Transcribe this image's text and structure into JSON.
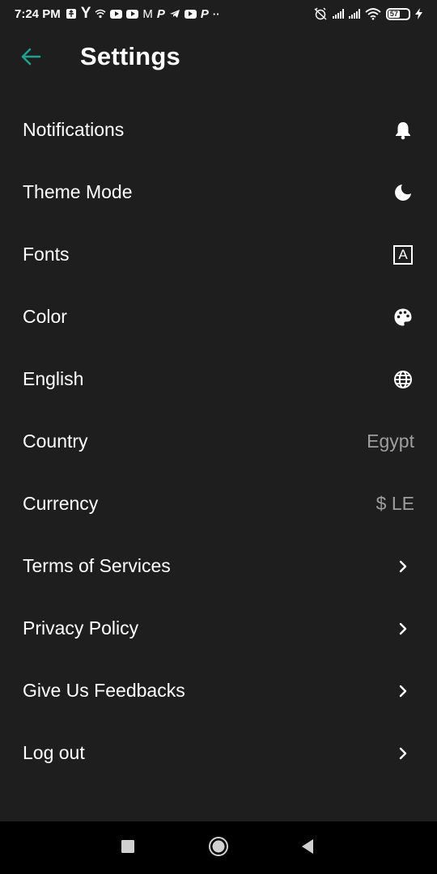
{
  "status_bar": {
    "time": "7:24 PM",
    "letter_y": "Y",
    "letter_m": "M",
    "letter_p": "P",
    "dots": "··",
    "battery_level": "57",
    "icons": [
      "usb-icon",
      "y-app-icon",
      "hotspot-icon",
      "youtube-icon",
      "youtube-icon",
      "gmail-icon",
      "paypal-icon",
      "telegram-icon",
      "youtube-icon",
      "paypal-icon",
      "more-dots-icon",
      "alarm-off-icon",
      "signal-icon",
      "signal-icon",
      "wifi-icon",
      "battery-icon",
      "charging-icon"
    ]
  },
  "header": {
    "title": "Settings",
    "back_icon": "arrow-back-icon",
    "accent_color": "#1fa38f"
  },
  "settings": {
    "items": [
      {
        "label": "Notifications",
        "trail_icon": "bell-icon"
      },
      {
        "label": "Theme Mode",
        "trail_icon": "moon-icon"
      },
      {
        "label": "Fonts",
        "trail_icon": "font-box-icon",
        "trail_icon_text": "A"
      },
      {
        "label": "Color",
        "trail_icon": "palette-icon"
      },
      {
        "label": "English",
        "trail_icon": "globe-icon"
      },
      {
        "label": "Country",
        "value": "Egypt"
      },
      {
        "label": "Currency",
        "value": "$ LE"
      },
      {
        "label": "Terms of Services",
        "trail_icon": "chevron-right-icon"
      },
      {
        "label": "Privacy Policy",
        "trail_icon": "chevron-right-icon"
      },
      {
        "label": "Give Us Feedbacks",
        "trail_icon": "chevron-right-icon"
      },
      {
        "label": "Log out",
        "trail_icon": "chevron-right-icon"
      }
    ]
  },
  "nav_bar": {
    "icons": [
      "recents-square-icon",
      "home-circle-icon",
      "back-triangle-icon"
    ]
  },
  "colors": {
    "background": "#1e1e1e",
    "text": "#ffffff",
    "secondary_text": "#9e9e9e",
    "nav_background": "#000000"
  }
}
